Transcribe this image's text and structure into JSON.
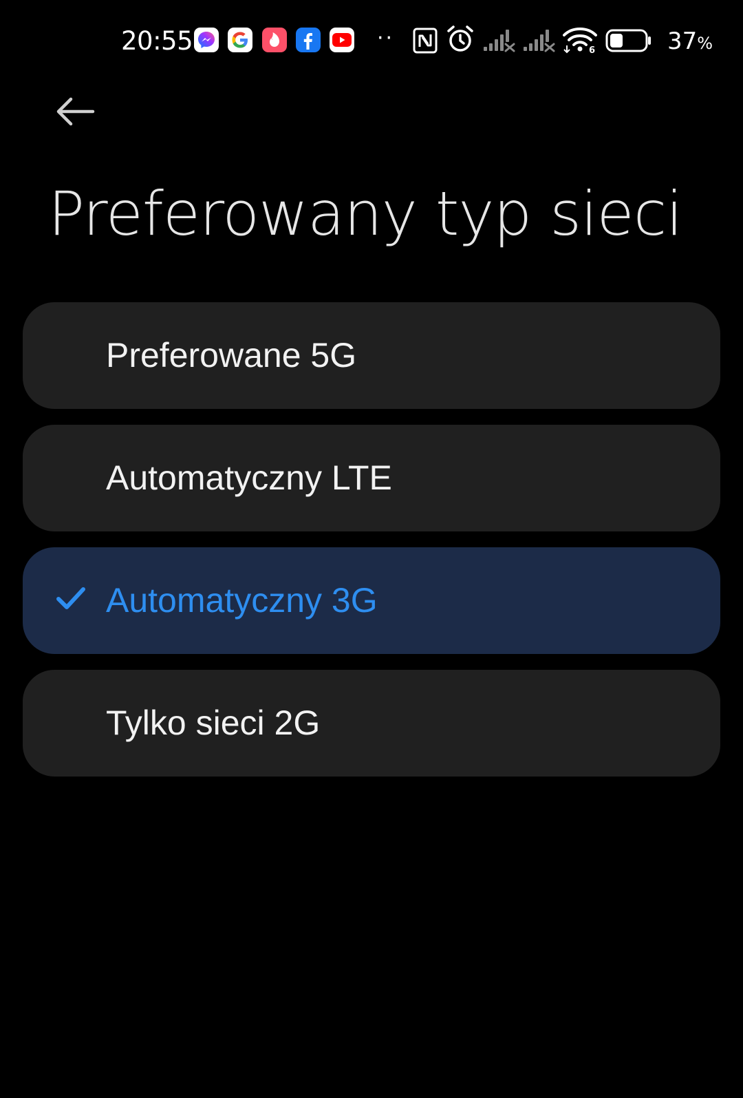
{
  "status_bar": {
    "time": "20:55",
    "notification_icons": [
      "messenger-icon",
      "google-icon",
      "tinder-icon",
      "facebook-icon",
      "youtube-icon"
    ],
    "more_indicator": "··",
    "system_icons": [
      "nfc-icon",
      "alarm-icon",
      "signal-1-no-service-icon",
      "signal-2-no-service-icon",
      "wifi-6-icon",
      "battery-icon"
    ],
    "battery_percent": "37",
    "battery_unit": "%",
    "battery_level": 0.37
  },
  "header": {
    "back_icon": "arrow-left-icon",
    "title": "Preferowany typ sieci"
  },
  "options": [
    {
      "label": "Preferowane 5G",
      "selected": false
    },
    {
      "label": "Automatyczny LTE",
      "selected": false
    },
    {
      "label": "Automatyczny 3G",
      "selected": true
    },
    {
      "label": "Tylko sieci 2G",
      "selected": false
    }
  ],
  "colors": {
    "background": "#000000",
    "option_background": "#202020",
    "selected_background": "#1c2b48",
    "accent": "#2e8ef0",
    "text": "#f2f2f2"
  }
}
